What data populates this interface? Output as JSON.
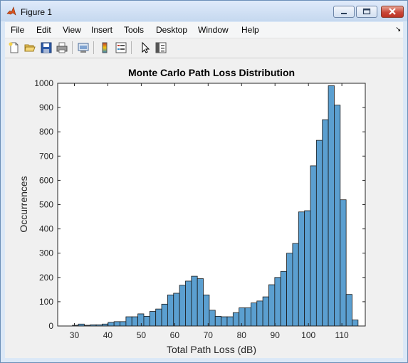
{
  "window": {
    "title": "Figure 1"
  },
  "menu": [
    "File",
    "Edit",
    "View",
    "Insert",
    "Tools",
    "Desktop",
    "Window",
    "Help"
  ],
  "toolbar_icons": [
    "new-figure-icon",
    "open-file-icon",
    "save-icon",
    "print-icon",
    "print-preview-icon",
    "colorbar-icon",
    "legend-icon",
    "select-arrow-icon",
    "property-editor-icon"
  ],
  "colors": {
    "bar_fill": "#5b9fd0",
    "bar_edge": "#1a1a1a",
    "axes_bg": "#ffffff",
    "figure_bg": "#f0f0f0"
  },
  "chart_data": {
    "type": "bar",
    "title": "Monte Carlo Path Loss Distribution",
    "xlabel": "Total Path Loss (dB)",
    "ylabel": "Occurrences",
    "xlim": [
      25,
      117
    ],
    "ylim": [
      0,
      1000
    ],
    "xticks": [
      30,
      40,
      50,
      60,
      70,
      80,
      90,
      100,
      110
    ],
    "yticks": [
      0,
      100,
      200,
      300,
      400,
      500,
      600,
      700,
      800,
      900,
      1000
    ],
    "grid": false,
    "bin_width": 1.78,
    "bin_edges_start": 29.4,
    "values": [
      3,
      8,
      3,
      5,
      5,
      8,
      15,
      18,
      18,
      38,
      38,
      50,
      40,
      60,
      70,
      90,
      128,
      135,
      168,
      185,
      205,
      195,
      128,
      65,
      40,
      38,
      38,
      55,
      75,
      75,
      95,
      103,
      120,
      170,
      200,
      225,
      300,
      340,
      470,
      475,
      660,
      765,
      850,
      990,
      910,
      520,
      130,
      25
    ]
  }
}
